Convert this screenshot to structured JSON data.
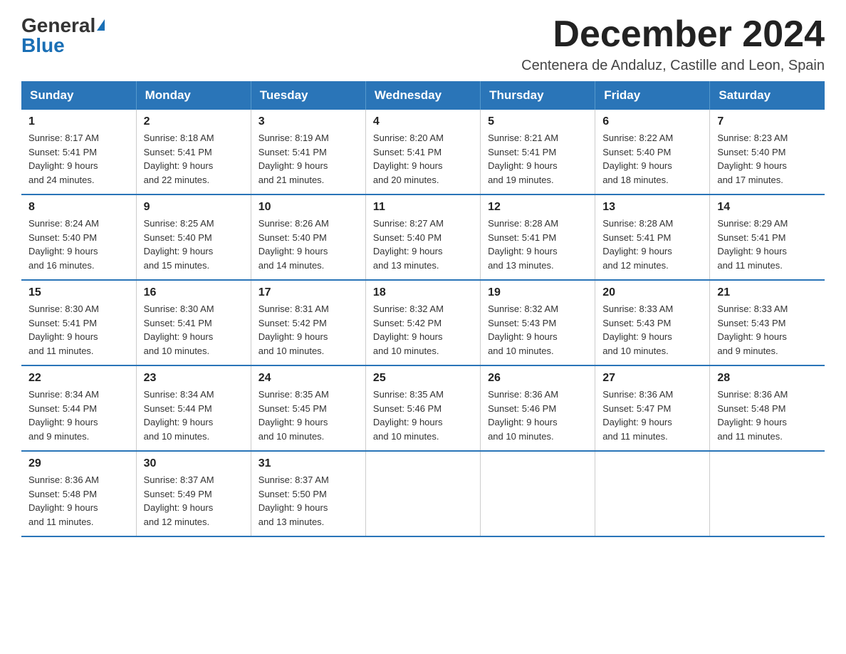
{
  "logo": {
    "general": "General",
    "blue": "Blue"
  },
  "header": {
    "month_title": "December 2024",
    "subtitle": "Centenera de Andaluz, Castille and Leon, Spain"
  },
  "weekdays": [
    "Sunday",
    "Monday",
    "Tuesday",
    "Wednesday",
    "Thursday",
    "Friday",
    "Saturday"
  ],
  "weeks": [
    [
      {
        "day": "1",
        "sunrise": "8:17 AM",
        "sunset": "5:41 PM",
        "daylight": "9 hours and 24 minutes."
      },
      {
        "day": "2",
        "sunrise": "8:18 AM",
        "sunset": "5:41 PM",
        "daylight": "9 hours and 22 minutes."
      },
      {
        "day": "3",
        "sunrise": "8:19 AM",
        "sunset": "5:41 PM",
        "daylight": "9 hours and 21 minutes."
      },
      {
        "day": "4",
        "sunrise": "8:20 AM",
        "sunset": "5:41 PM",
        "daylight": "9 hours and 20 minutes."
      },
      {
        "day": "5",
        "sunrise": "8:21 AM",
        "sunset": "5:41 PM",
        "daylight": "9 hours and 19 minutes."
      },
      {
        "day": "6",
        "sunrise": "8:22 AM",
        "sunset": "5:40 PM",
        "daylight": "9 hours and 18 minutes."
      },
      {
        "day": "7",
        "sunrise": "8:23 AM",
        "sunset": "5:40 PM",
        "daylight": "9 hours and 17 minutes."
      }
    ],
    [
      {
        "day": "8",
        "sunrise": "8:24 AM",
        "sunset": "5:40 PM",
        "daylight": "9 hours and 16 minutes."
      },
      {
        "day": "9",
        "sunrise": "8:25 AM",
        "sunset": "5:40 PM",
        "daylight": "9 hours and 15 minutes."
      },
      {
        "day": "10",
        "sunrise": "8:26 AM",
        "sunset": "5:40 PM",
        "daylight": "9 hours and 14 minutes."
      },
      {
        "day": "11",
        "sunrise": "8:27 AM",
        "sunset": "5:40 PM",
        "daylight": "9 hours and 13 minutes."
      },
      {
        "day": "12",
        "sunrise": "8:28 AM",
        "sunset": "5:41 PM",
        "daylight": "9 hours and 13 minutes."
      },
      {
        "day": "13",
        "sunrise": "8:28 AM",
        "sunset": "5:41 PM",
        "daylight": "9 hours and 12 minutes."
      },
      {
        "day": "14",
        "sunrise": "8:29 AM",
        "sunset": "5:41 PM",
        "daylight": "9 hours and 11 minutes."
      }
    ],
    [
      {
        "day": "15",
        "sunrise": "8:30 AM",
        "sunset": "5:41 PM",
        "daylight": "9 hours and 11 minutes."
      },
      {
        "day": "16",
        "sunrise": "8:30 AM",
        "sunset": "5:41 PM",
        "daylight": "9 hours and 10 minutes."
      },
      {
        "day": "17",
        "sunrise": "8:31 AM",
        "sunset": "5:42 PM",
        "daylight": "9 hours and 10 minutes."
      },
      {
        "day": "18",
        "sunrise": "8:32 AM",
        "sunset": "5:42 PM",
        "daylight": "9 hours and 10 minutes."
      },
      {
        "day": "19",
        "sunrise": "8:32 AM",
        "sunset": "5:43 PM",
        "daylight": "9 hours and 10 minutes."
      },
      {
        "day": "20",
        "sunrise": "8:33 AM",
        "sunset": "5:43 PM",
        "daylight": "9 hours and 10 minutes."
      },
      {
        "day": "21",
        "sunrise": "8:33 AM",
        "sunset": "5:43 PM",
        "daylight": "9 hours and 9 minutes."
      }
    ],
    [
      {
        "day": "22",
        "sunrise": "8:34 AM",
        "sunset": "5:44 PM",
        "daylight": "9 hours and 9 minutes."
      },
      {
        "day": "23",
        "sunrise": "8:34 AM",
        "sunset": "5:44 PM",
        "daylight": "9 hours and 10 minutes."
      },
      {
        "day": "24",
        "sunrise": "8:35 AM",
        "sunset": "5:45 PM",
        "daylight": "9 hours and 10 minutes."
      },
      {
        "day": "25",
        "sunrise": "8:35 AM",
        "sunset": "5:46 PM",
        "daylight": "9 hours and 10 minutes."
      },
      {
        "day": "26",
        "sunrise": "8:36 AM",
        "sunset": "5:46 PM",
        "daylight": "9 hours and 10 minutes."
      },
      {
        "day": "27",
        "sunrise": "8:36 AM",
        "sunset": "5:47 PM",
        "daylight": "9 hours and 11 minutes."
      },
      {
        "day": "28",
        "sunrise": "8:36 AM",
        "sunset": "5:48 PM",
        "daylight": "9 hours and 11 minutes."
      }
    ],
    [
      {
        "day": "29",
        "sunrise": "8:36 AM",
        "sunset": "5:48 PM",
        "daylight": "9 hours and 11 minutes."
      },
      {
        "day": "30",
        "sunrise": "8:37 AM",
        "sunset": "5:49 PM",
        "daylight": "9 hours and 12 minutes."
      },
      {
        "day": "31",
        "sunrise": "8:37 AM",
        "sunset": "5:50 PM",
        "daylight": "9 hours and 13 minutes."
      },
      null,
      null,
      null,
      null
    ]
  ],
  "labels": {
    "sunrise": "Sunrise:",
    "sunset": "Sunset:",
    "daylight": "Daylight:"
  }
}
